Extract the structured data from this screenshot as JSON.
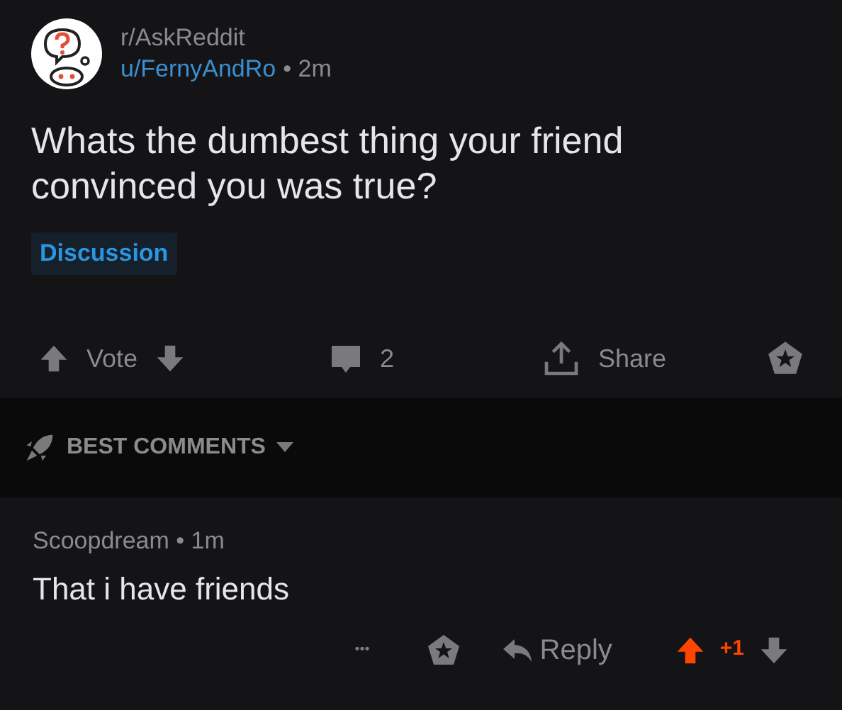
{
  "post": {
    "subreddit": "r/AskReddit",
    "author": "u/FernyAndRo",
    "separator": "•",
    "age": "2m",
    "title": "Whats the dumbest thing your friend convinced you was true?",
    "flair": "Discussion",
    "vote_label": "Vote",
    "upvoted": false,
    "comment_count": "2",
    "share_label": "Share"
  },
  "sort": {
    "label": "BEST COMMENTS"
  },
  "comments": [
    {
      "author": "Scoopdream",
      "separator": "•",
      "age": "1m",
      "body": "That i have friends",
      "more": "•••",
      "reply_label": "Reply",
      "score": "+1",
      "upvoted": true
    }
  ]
}
